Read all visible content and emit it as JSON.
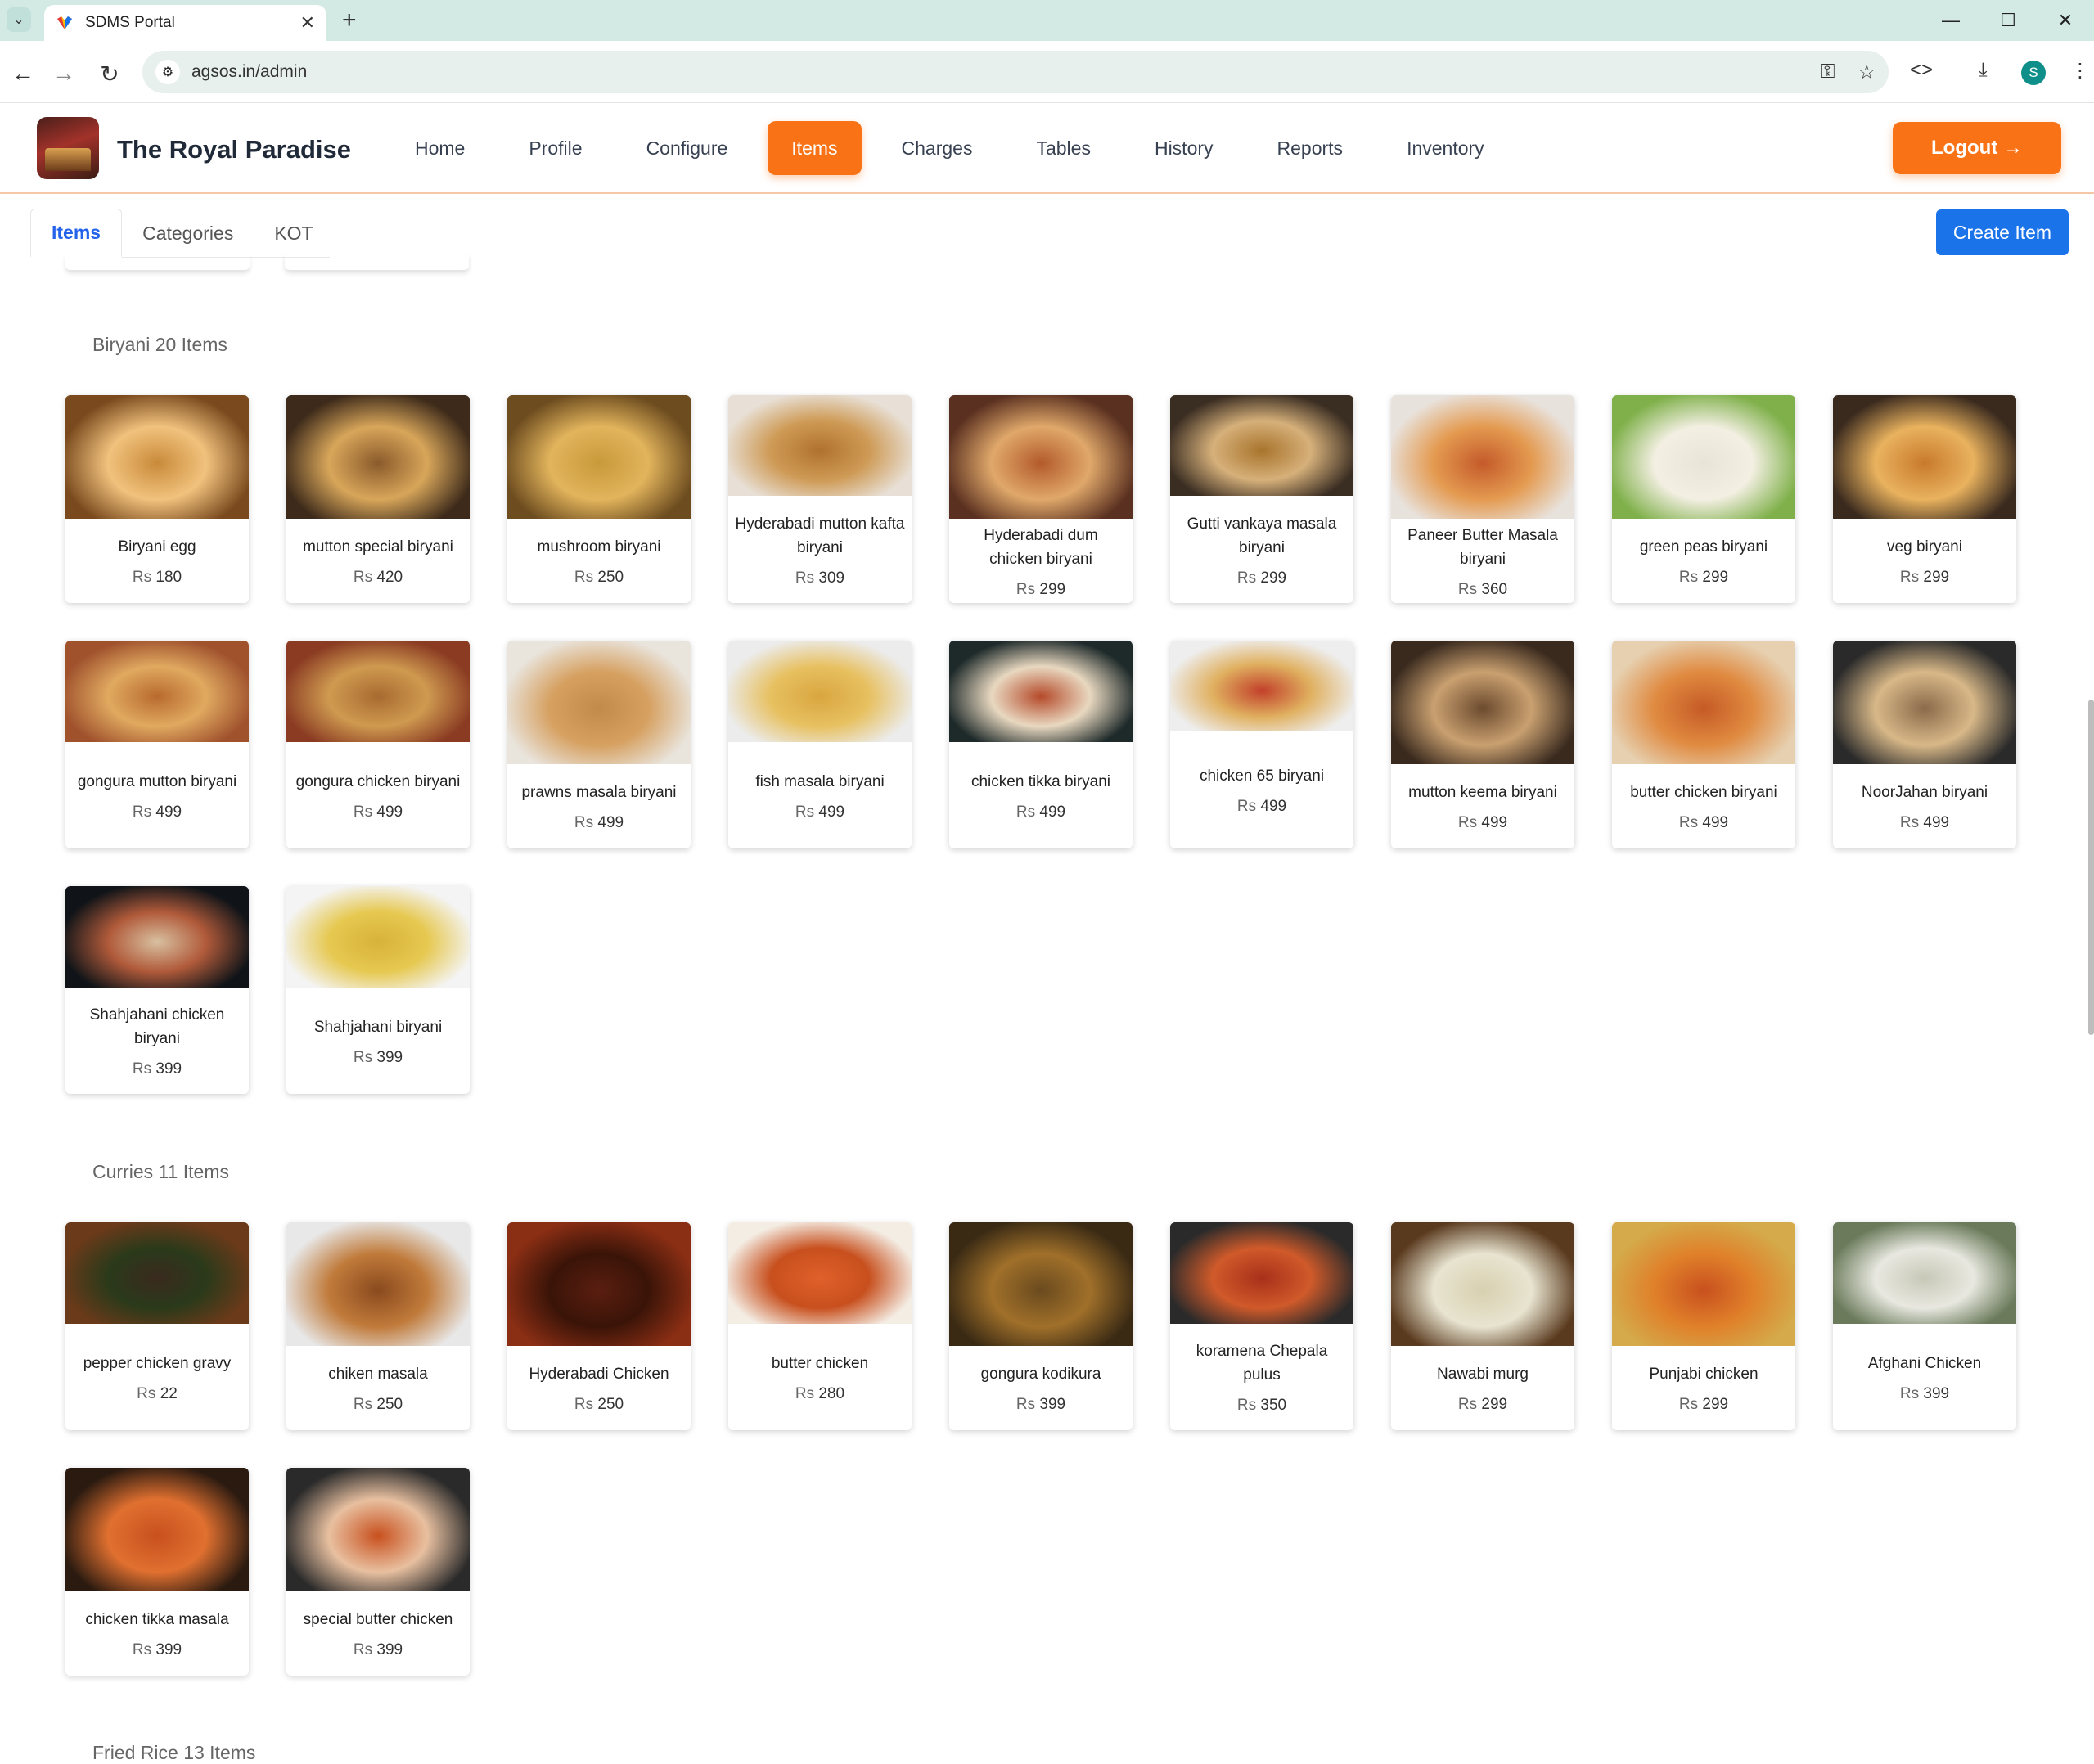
{
  "browser": {
    "tab_title": "SDMS Portal",
    "url": "agsos.in/admin",
    "profile_initial": "S"
  },
  "app": {
    "brand": "The Royal Paradise",
    "menu": [
      "Home",
      "Profile",
      "Configure",
      "Items",
      "Charges",
      "Tables",
      "History",
      "Reports",
      "Inventory"
    ],
    "active_menu": "Items",
    "logout_label": "Logout →"
  },
  "subtabs": [
    "Items",
    "Categories",
    "KOT"
  ],
  "create_button": "Create Item",
  "currency": "Rs",
  "sections": [
    {
      "title": "Biryani 20 Items",
      "items": [
        {
          "name": "Biryani egg",
          "price": "180"
        },
        {
          "name": "mutton special biryani",
          "price": "420"
        },
        {
          "name": "mushroom biryani",
          "price": "250"
        },
        {
          "name": "Hyderabadi mutton kafta biryani",
          "price": "309"
        },
        {
          "name": "Hyderabadi dum chicken biryani",
          "price": "299"
        },
        {
          "name": "Gutti vankaya masala biryani",
          "price": "299"
        },
        {
          "name": "Paneer Butter Masala biryani",
          "price": "360"
        },
        {
          "name": "green peas biryani",
          "price": "299"
        },
        {
          "name": "veg biryani",
          "price": "299"
        },
        {
          "name": "gongura mutton biryani",
          "price": "499"
        },
        {
          "name": "gongura chicken biryani",
          "price": "499"
        },
        {
          "name": "prawns masala biryani",
          "price": "499"
        },
        {
          "name": "fish masala biryani",
          "price": "499"
        },
        {
          "name": "chicken tikka biryani",
          "price": "499"
        },
        {
          "name": "chicken 65 biryani",
          "price": "499"
        },
        {
          "name": "mutton keema biryani",
          "price": "499"
        },
        {
          "name": "butter chicken biryani",
          "price": "499"
        },
        {
          "name": "NoorJahan biryani",
          "price": "499"
        },
        {
          "name": "Shahjahani chicken biryani",
          "price": "399"
        },
        {
          "name": "Shahjahani biryani",
          "price": "399"
        }
      ]
    },
    {
      "title": "Curries 11 Items",
      "items": [
        {
          "name": "pepper chicken gravy",
          "price": "22"
        },
        {
          "name": "chiken masala",
          "price": "250"
        },
        {
          "name": "Hyderabadi Chicken",
          "price": "250"
        },
        {
          "name": "butter chicken",
          "price": "280"
        },
        {
          "name": "gongura kodikura",
          "price": "399"
        },
        {
          "name": "koramena Chepala pulus",
          "price": "350"
        },
        {
          "name": "Nawabi murg",
          "price": "299"
        },
        {
          "name": "Punjabi chicken",
          "price": "299"
        },
        {
          "name": "Afghani Chicken",
          "price": "399"
        },
        {
          "name": "chicken tikka masala",
          "price": "399"
        },
        {
          "name": "special butter chicken",
          "price": "399"
        }
      ]
    },
    {
      "title": "Fried Rice 13 Items",
      "items": []
    }
  ],
  "colors": {
    "accent": "#f97316",
    "primary": "#1a73e8",
    "tab_active": "#2563eb"
  }
}
